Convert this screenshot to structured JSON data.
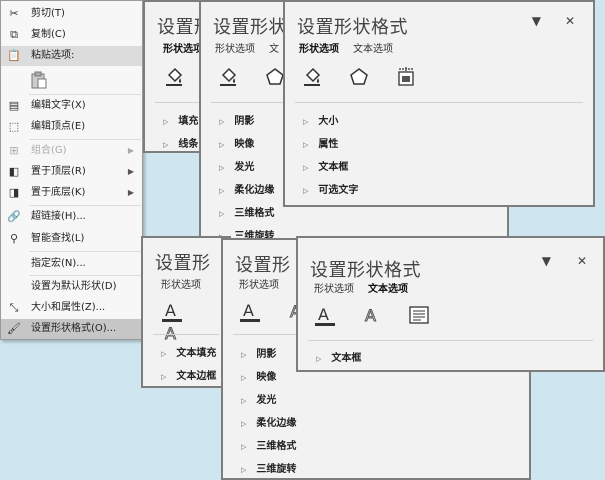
{
  "context_menu": {
    "items": [
      {
        "label": "剪切(T)"
      },
      {
        "label": "复制(C)"
      },
      {
        "label": "粘贴选项:"
      },
      {
        "label": "编辑文字(X)"
      },
      {
        "label": "编辑顶点(E)"
      },
      {
        "label": "组合(G)"
      },
      {
        "label": "置于顶层(R)"
      },
      {
        "label": "置于底层(K)"
      },
      {
        "label": "超链接(H)..."
      },
      {
        "label": "智能查找(L)"
      },
      {
        "label": "指定宏(N)..."
      },
      {
        "label": "设置为默认形状(D)"
      },
      {
        "label": "大小和属性(Z)..."
      },
      {
        "label": "设置形状格式(O)..."
      }
    ]
  },
  "panes": {
    "title": "设置形状格式",
    "title_clipped_a": "设置形",
    "title_clipped_b": "设置形状",
    "tab_shape": "形状选项",
    "tab_text": "文本选项",
    "tab_text_clipped": "文",
    "close_glyph": "✕",
    "menu_glyph": "▼",
    "sections_fill": [
      "填充",
      "线条"
    ],
    "sections_fill_clipped": [
      "填充",
      "线条"
    ],
    "sections_effects": [
      "阴影",
      "映像",
      "发光",
      "柔化边缘",
      "三维格式",
      "三维旋转"
    ],
    "sections_size": [
      "大小",
      "属性",
      "文本框",
      "可选文字"
    ],
    "sections_textfill": [
      "文本填充",
      "文本边框"
    ],
    "sections_textbox": [
      "文本框"
    ]
  }
}
